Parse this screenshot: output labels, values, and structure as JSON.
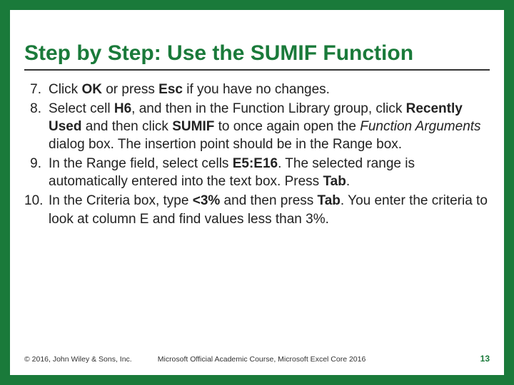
{
  "title": "Step by Step: Use the SUMIF Function",
  "items": [
    {
      "num": "7.",
      "parts": [
        {
          "t": "Click "
        },
        {
          "t": "OK",
          "b": true
        },
        {
          "t": " or press "
        },
        {
          "t": "Esc",
          "b": true
        },
        {
          "t": " if you have no changes."
        }
      ]
    },
    {
      "num": "8.",
      "parts": [
        {
          "t": "Select cell "
        },
        {
          "t": "H6",
          "b": true
        },
        {
          "t": ", and then in the Function Library group, click "
        },
        {
          "t": "Recently Used",
          "b": true
        },
        {
          "t": " and then click "
        },
        {
          "t": "SUMIF",
          "b": true
        },
        {
          "t": " to once again open the "
        },
        {
          "t": "Function Arguments",
          "i": true
        },
        {
          "t": " dialog box. The insertion point should be in the Range box."
        }
      ]
    },
    {
      "num": "9.",
      "parts": [
        {
          "t": "In the Range field, select cells "
        },
        {
          "t": "E5:E16",
          "b": true
        },
        {
          "t": ". The selected range is automatically entered into the text box. Press "
        },
        {
          "t": "Tab",
          "b": true
        },
        {
          "t": "."
        }
      ]
    },
    {
      "num": "10.",
      "parts": [
        {
          "t": "In the Criteria box, type "
        },
        {
          "t": "<3%",
          "b": true
        },
        {
          "t": " and then press "
        },
        {
          "t": "Tab",
          "b": true
        },
        {
          "t": ". You enter the criteria to look at column E and find values less than 3%."
        }
      ]
    }
  ],
  "footer": {
    "copyright": "© 2016, John Wiley & Sons, Inc.",
    "course": "Microsoft Official Academic Course, Microsoft Excel Core 2016",
    "page": "13"
  }
}
